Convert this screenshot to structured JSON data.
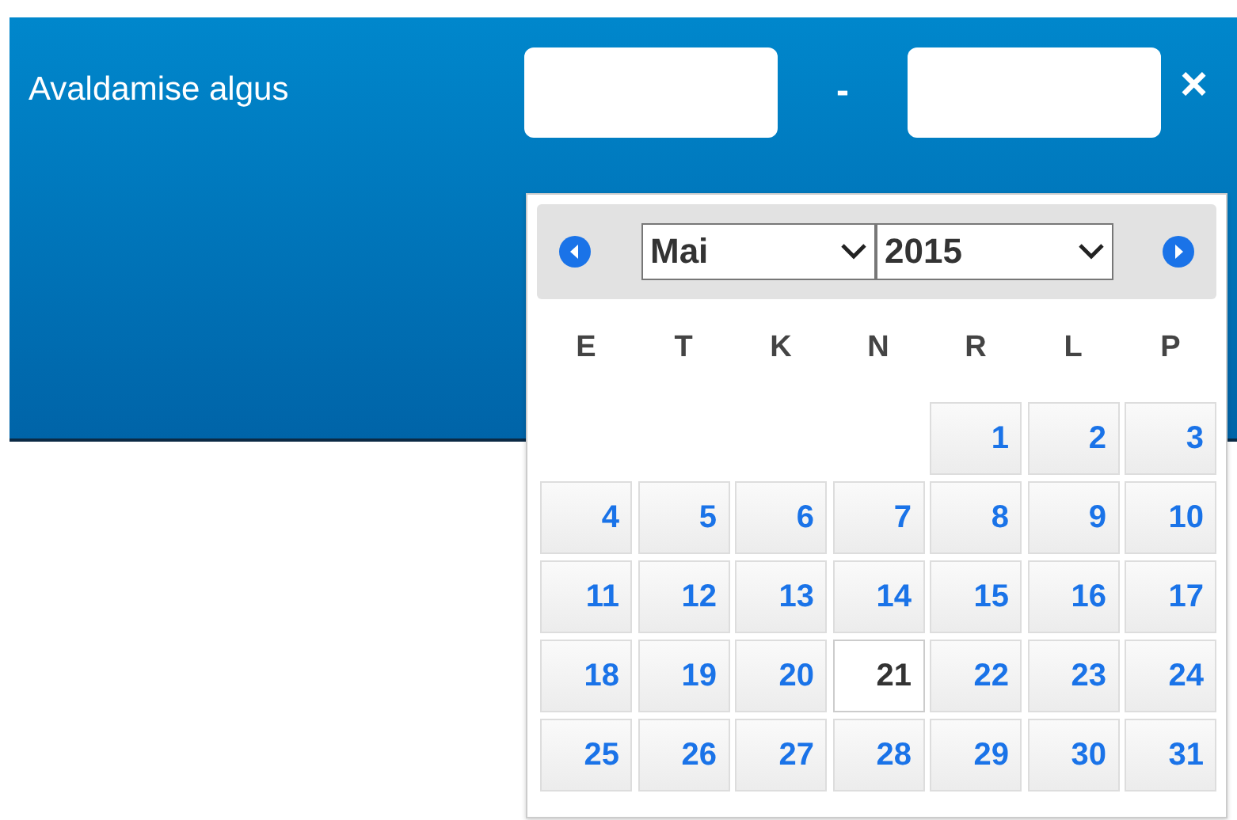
{
  "filter": {
    "label": "Avaldamise algus",
    "separator": "-",
    "clear": "×"
  },
  "calendar": {
    "month": "Mai",
    "year": "2015",
    "weekdays": [
      "E",
      "T",
      "K",
      "N",
      "R",
      "L",
      "P"
    ],
    "weeks": [
      [
        {
          "label": "1",
          "selected": false
        },
        {
          "label": "2",
          "selected": false
        },
        {
          "label": "3",
          "selected": false
        }
      ],
      [
        {
          "label": "4",
          "selected": false
        },
        {
          "label": "5",
          "selected": false
        },
        {
          "label": "6",
          "selected": false
        },
        {
          "label": "7",
          "selected": false
        },
        {
          "label": "8",
          "selected": false
        },
        {
          "label": "9",
          "selected": false
        },
        {
          "label": "10",
          "selected": false
        }
      ],
      [
        {
          "label": "11",
          "selected": false
        },
        {
          "label": "12",
          "selected": false
        },
        {
          "label": "13",
          "selected": false
        },
        {
          "label": "14",
          "selected": false
        },
        {
          "label": "15",
          "selected": false
        },
        {
          "label": "16",
          "selected": false
        },
        {
          "label": "17",
          "selected": false
        }
      ],
      [
        {
          "label": "18",
          "selected": false
        },
        {
          "label": "19",
          "selected": false
        },
        {
          "label": "20",
          "selected": false
        },
        {
          "label": "21",
          "selected": true
        },
        {
          "label": "22",
          "selected": false
        },
        {
          "label": "23",
          "selected": false
        },
        {
          "label": "24",
          "selected": false
        }
      ],
      [
        {
          "label": "25",
          "selected": false
        },
        {
          "label": "26",
          "selected": false
        },
        {
          "label": "27",
          "selected": false
        },
        {
          "label": "28",
          "selected": false
        },
        {
          "label": "29",
          "selected": false
        },
        {
          "label": "30",
          "selected": false
        },
        {
          "label": "31",
          "selected": false
        }
      ]
    ]
  }
}
